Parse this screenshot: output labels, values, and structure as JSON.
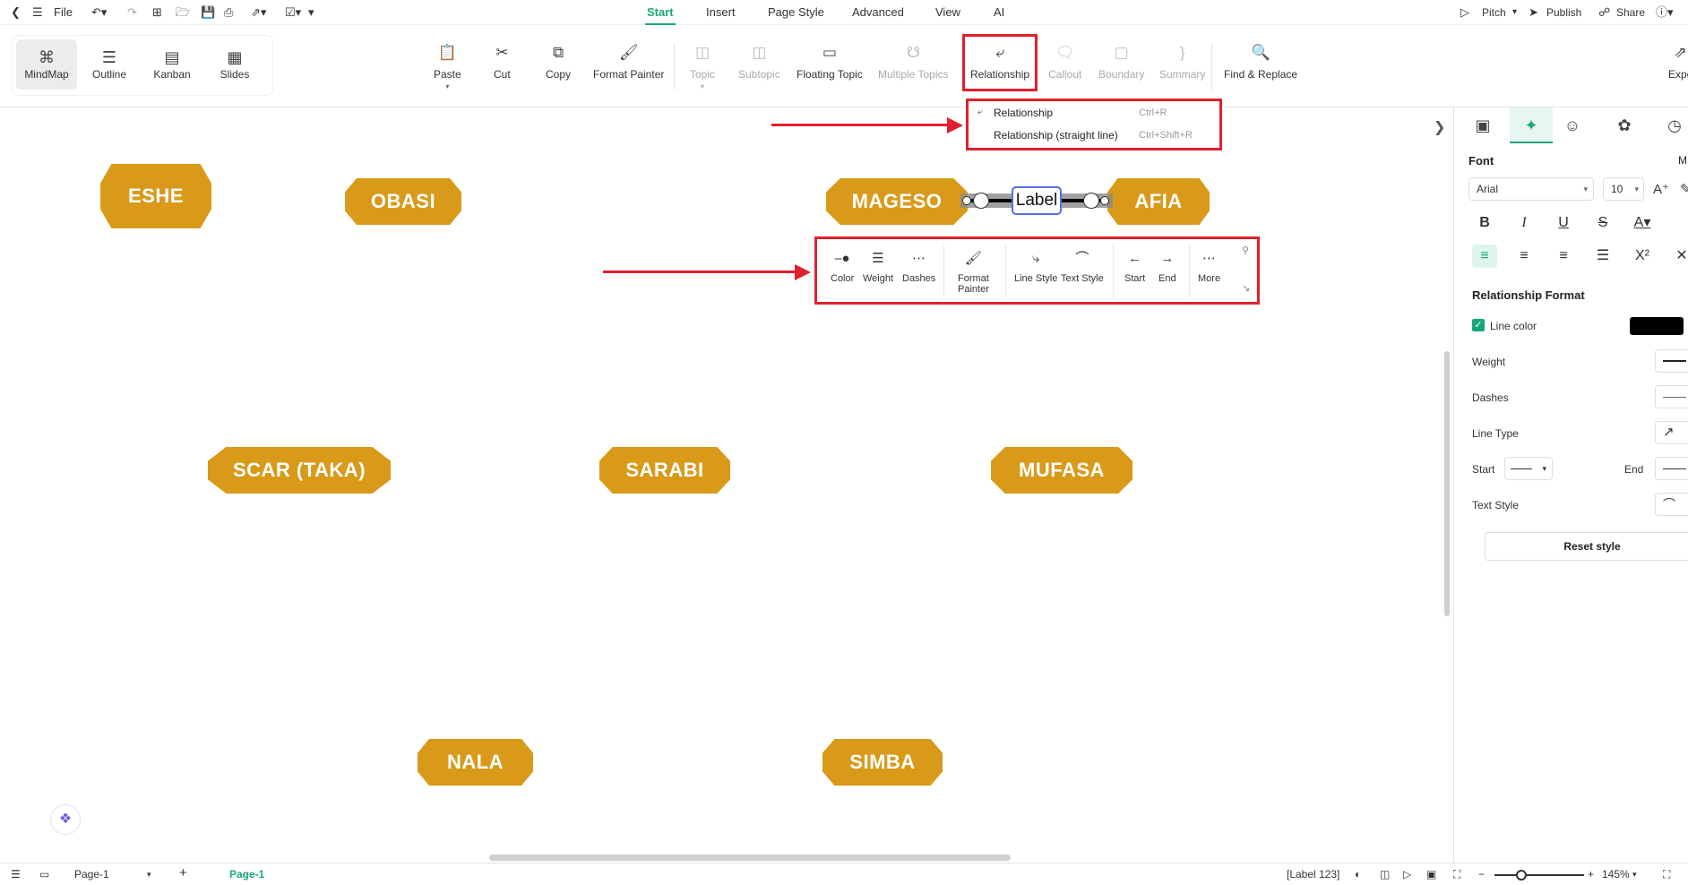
{
  "titlebar": {
    "file": "File",
    "menus": [
      "Start",
      "Insert",
      "Page Style",
      "Advanced",
      "View",
      "AI"
    ],
    "active_menu": "Start",
    "pitch": "Pitch",
    "publish": "Publish",
    "share": "Share"
  },
  "views": [
    "MindMap",
    "Outline",
    "Kanban",
    "Slides"
  ],
  "ribbon": {
    "paste": "Paste",
    "cut": "Cut",
    "copy": "Copy",
    "format_painter": "Format Painter",
    "topic": "Topic",
    "subtopic": "Subtopic",
    "floating_topic": "Floating Topic",
    "multiple_topics": "Multiple Topics",
    "relationship": "Relationship",
    "callout": "Callout",
    "boundary": "Boundary",
    "summary": "Summary",
    "find_replace": "Find & Replace",
    "export": "Expo"
  },
  "dropdown": {
    "items": [
      {
        "label": "Relationship",
        "shortcut": "Ctrl+R"
      },
      {
        "label": "Relationship (straight line)",
        "shortcut": "Ctrl+Shift+R"
      }
    ]
  },
  "nodes": {
    "eshe": "ESHE",
    "obasi": "OBASI",
    "mageso": "MAGESO",
    "afia": "AFIA",
    "scar": "SCAR (TAKA)",
    "sarabi": "SARABI",
    "mufasa": "MUFASA",
    "nala": "NALA",
    "simba": "SIMBA"
  },
  "relationship_label": "Label",
  "floatbar": {
    "color": "Color",
    "weight": "Weight",
    "dashes": "Dashes",
    "format_painter_1": "Format",
    "format_painter_2": "Painter",
    "line_style": "Line Style",
    "text_style": "Text Style",
    "start": "Start",
    "end": "End",
    "more": "More"
  },
  "panel": {
    "font_heading": "Font",
    "font_family": "Arial",
    "font_size": "10",
    "truncated": "M",
    "section": "Relationship Format",
    "line_color": "Line color",
    "weight": "Weight",
    "dashes": "Dashes",
    "line_type": "Line Type",
    "start": "Start",
    "end": "End",
    "text_style": "Text Style",
    "reset": "Reset style"
  },
  "status": {
    "page_select": "Page-1",
    "page_tab": "Page-1",
    "selection": "[Label 123]",
    "zoom": "145%"
  },
  "colors": {
    "accent": "#18a77a",
    "node": "#d99a1a",
    "highlight": "#e0202e"
  }
}
